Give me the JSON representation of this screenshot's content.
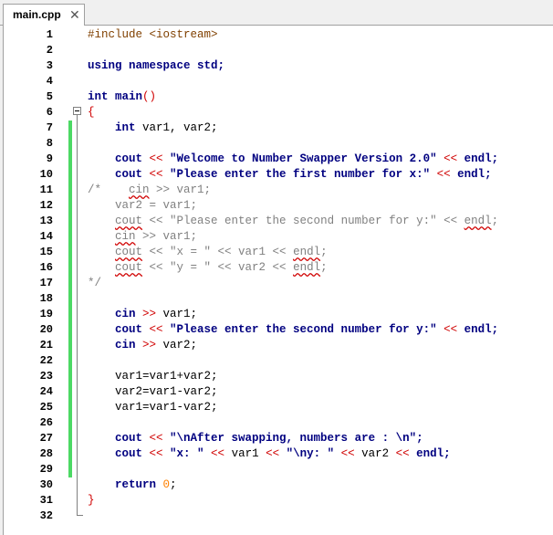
{
  "tab": {
    "title": "main.cpp",
    "close_glyph": "✕"
  },
  "lines": [
    {
      "n": "1",
      "segs": [
        {
          "t": "#include <iostream>",
          "c": "pp"
        }
      ]
    },
    {
      "n": "2",
      "segs": []
    },
    {
      "n": "3",
      "segs": [
        {
          "t": "using namespace std;",
          "c": "kw"
        }
      ]
    },
    {
      "n": "4",
      "segs": []
    },
    {
      "n": "5",
      "segs": [
        {
          "t": "int main",
          "c": "kw"
        },
        {
          "t": "()",
          "c": "op"
        }
      ]
    },
    {
      "n": "6",
      "segs": [
        {
          "t": "{",
          "c": "op"
        }
      ]
    },
    {
      "n": "7",
      "segs": [
        {
          "t": "    int ",
          "c": "kw"
        },
        {
          "t": "var1, var2;",
          "c": "plain"
        }
      ]
    },
    {
      "n": "8",
      "segs": []
    },
    {
      "n": "9",
      "segs": [
        {
          "t": "    cout ",
          "c": "kw"
        },
        {
          "t": "<< ",
          "c": "op"
        },
        {
          "t": "\"Welcome to Number Swapper Version 2.0\" ",
          "c": "str"
        },
        {
          "t": "<< ",
          "c": "op"
        },
        {
          "t": "endl;",
          "c": "kw"
        }
      ]
    },
    {
      "n": "10",
      "segs": [
        {
          "t": "    cout ",
          "c": "kw"
        },
        {
          "t": "<< ",
          "c": "op"
        },
        {
          "t": "\"Please enter the first number for x:\" ",
          "c": "str"
        },
        {
          "t": "<< ",
          "c": "op"
        },
        {
          "t": "endl;",
          "c": "kw"
        }
      ]
    },
    {
      "n": "11",
      "segs": [
        {
          "t": "/*    cin >> var1;",
          "c": "cm"
        }
      ]
    },
    {
      "n": "12",
      "segs": [
        {
          "t": "    var2 = var1;",
          "c": "cm"
        }
      ]
    },
    {
      "n": "13",
      "segs": [
        {
          "t": "    cout << \"Please enter the second number for y:\" << endl;",
          "c": "cm"
        }
      ]
    },
    {
      "n": "14",
      "segs": [
        {
          "t": "    cin >> var1;",
          "c": "cm"
        }
      ]
    },
    {
      "n": "15",
      "segs": [
        {
          "t": "    cout << \"x = \" << var1 << endl;",
          "c": "cm"
        }
      ]
    },
    {
      "n": "16",
      "segs": [
        {
          "t": "    cout << \"y = \" << var2 << endl;",
          "c": "cm"
        }
      ]
    },
    {
      "n": "17",
      "segs": [
        {
          "t": "*/",
          "c": "cm"
        }
      ]
    },
    {
      "n": "18",
      "segs": []
    },
    {
      "n": "19",
      "segs": [
        {
          "t": "    cin ",
          "c": "kw"
        },
        {
          "t": ">> ",
          "c": "op"
        },
        {
          "t": "var1;",
          "c": "plain"
        }
      ]
    },
    {
      "n": "20",
      "segs": [
        {
          "t": "    cout ",
          "c": "kw"
        },
        {
          "t": "<< ",
          "c": "op"
        },
        {
          "t": "\"Please enter the second number for y:\" ",
          "c": "str"
        },
        {
          "t": "<< ",
          "c": "op"
        },
        {
          "t": "endl;",
          "c": "kw"
        }
      ]
    },
    {
      "n": "21",
      "segs": [
        {
          "t": "    cin ",
          "c": "kw"
        },
        {
          "t": ">> ",
          "c": "op"
        },
        {
          "t": "var2;",
          "c": "plain"
        }
      ]
    },
    {
      "n": "22",
      "segs": []
    },
    {
      "n": "23",
      "segs": [
        {
          "t": "    var1=var1+var2;",
          "c": "plain"
        }
      ]
    },
    {
      "n": "24",
      "segs": [
        {
          "t": "    var2=var1-var2;",
          "c": "plain"
        }
      ]
    },
    {
      "n": "25",
      "segs": [
        {
          "t": "    var1=var1-var2;",
          "c": "plain"
        }
      ]
    },
    {
      "n": "26",
      "segs": []
    },
    {
      "n": "27",
      "segs": [
        {
          "t": "    cout ",
          "c": "kw"
        },
        {
          "t": "<< ",
          "c": "op"
        },
        {
          "t": "\"\\nAfter swapping, numbers are : \\n\";",
          "c": "str"
        }
      ]
    },
    {
      "n": "28",
      "segs": [
        {
          "t": "    cout ",
          "c": "kw"
        },
        {
          "t": "<< ",
          "c": "op"
        },
        {
          "t": "\"x: \" ",
          "c": "str"
        },
        {
          "t": "<< ",
          "c": "op"
        },
        {
          "t": "var1 ",
          "c": "plain"
        },
        {
          "t": "<< ",
          "c": "op"
        },
        {
          "t": "\"\\ny: \" ",
          "c": "str"
        },
        {
          "t": "<< ",
          "c": "op"
        },
        {
          "t": "var2 ",
          "c": "plain"
        },
        {
          "t": "<< ",
          "c": "op"
        },
        {
          "t": "endl;",
          "c": "kw"
        }
      ]
    },
    {
      "n": "29",
      "segs": []
    },
    {
      "n": "30",
      "segs": [
        {
          "t": "    return ",
          "c": "kw"
        },
        {
          "t": "0",
          "c": "num"
        },
        {
          "t": ";",
          "c": "plain"
        }
      ]
    },
    {
      "n": "31",
      "segs": [
        {
          "t": "}",
          "c": "op"
        }
      ]
    },
    {
      "n": "32",
      "segs": []
    }
  ],
  "changed_lines": [
    "7",
    "8",
    "9",
    "10",
    "11",
    "12",
    "13",
    "14",
    "15",
    "16",
    "17",
    "18",
    "19",
    "20",
    "21",
    "22",
    "23",
    "24",
    "25",
    "26",
    "27",
    "28",
    "29"
  ],
  "colors": {
    "change_bar": "#4cd964",
    "keyword": "#000080",
    "operator": "#d00000",
    "comment": "#808080",
    "preprocessor": "#804000",
    "number": "#ff8000"
  }
}
